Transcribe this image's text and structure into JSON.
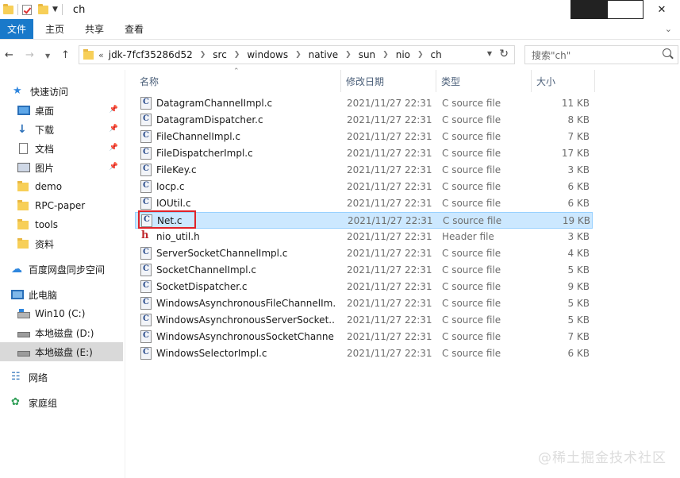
{
  "window": {
    "title": "ch",
    "controls": {
      "minimize": "minimize",
      "maximize": "maximize",
      "close": "✕"
    }
  },
  "quick_access_toolbar": {
    "icons": [
      "folder-icon",
      "properties-icon",
      "new-folder-icon",
      "customize-dropdown-icon"
    ]
  },
  "ribbon": {
    "tabs": [
      {
        "label": "文件",
        "active": true
      },
      {
        "label": "主页"
      },
      {
        "label": "共享"
      },
      {
        "label": "查看"
      }
    ]
  },
  "navigation": {
    "back": "←",
    "forward": "→",
    "up": "↑",
    "address": {
      "lead": "«",
      "crumbs": [
        "jdk-7fcf35286d52",
        "src",
        "windows",
        "native",
        "sun",
        "nio",
        "ch"
      ]
    },
    "search": {
      "placeholder": "搜索\"ch\""
    }
  },
  "sidebar": {
    "quick_access": {
      "label": "快速访问"
    },
    "pinned": [
      {
        "label": "桌面",
        "icon": "desktop-icon",
        "pinned": true
      },
      {
        "label": "下载",
        "icon": "download-icon",
        "pinned": true
      },
      {
        "label": "文档",
        "icon": "document-icon",
        "pinned": true
      },
      {
        "label": "图片",
        "icon": "pictures-icon",
        "pinned": true
      }
    ],
    "folders": [
      {
        "label": "demo"
      },
      {
        "label": "RPC-paper"
      },
      {
        "label": "tools"
      },
      {
        "label": "资料"
      }
    ],
    "baidu": {
      "label": "百度网盘同步空间"
    },
    "this_pc": {
      "label": "此电脑"
    },
    "drives": [
      {
        "label": "Win10 (C:)"
      },
      {
        "label": "本地磁盘 (D:)"
      },
      {
        "label": "本地磁盘 (E:)",
        "selected": true
      }
    ],
    "network": {
      "label": "网络"
    },
    "homegroup": {
      "label": "家庭组"
    }
  },
  "columns": {
    "name": "名称",
    "date": "修改日期",
    "type": "类型",
    "size": "大小"
  },
  "files": [
    {
      "name": "DatagramChannelImpl.c",
      "date": "2021/11/27 22:31",
      "type": "C source file",
      "size": "11 KB",
      "kind": "c"
    },
    {
      "name": "DatagramDispatcher.c",
      "date": "2021/11/27 22:31",
      "type": "C source file",
      "size": "8 KB",
      "kind": "c"
    },
    {
      "name": "FileChannelImpl.c",
      "date": "2021/11/27 22:31",
      "type": "C source file",
      "size": "7 KB",
      "kind": "c"
    },
    {
      "name": "FileDispatcherImpl.c",
      "date": "2021/11/27 22:31",
      "type": "C source file",
      "size": "17 KB",
      "kind": "c"
    },
    {
      "name": "FileKey.c",
      "date": "2021/11/27 22:31",
      "type": "C source file",
      "size": "3 KB",
      "kind": "c"
    },
    {
      "name": "Iocp.c",
      "date": "2021/11/27 22:31",
      "type": "C source file",
      "size": "6 KB",
      "kind": "c"
    },
    {
      "name": "IOUtil.c",
      "date": "2021/11/27 22:31",
      "type": "C source file",
      "size": "6 KB",
      "kind": "c"
    },
    {
      "name": "Net.c",
      "date": "2021/11/27 22:31",
      "type": "C source file",
      "size": "19 KB",
      "kind": "c",
      "selected": true
    },
    {
      "name": "nio_util.h",
      "date": "2021/11/27 22:31",
      "type": "Header file",
      "size": "3 KB",
      "kind": "h"
    },
    {
      "name": "ServerSocketChannelImpl.c",
      "date": "2021/11/27 22:31",
      "type": "C source file",
      "size": "4 KB",
      "kind": "c"
    },
    {
      "name": "SocketChannelImpl.c",
      "date": "2021/11/27 22:31",
      "type": "C source file",
      "size": "5 KB",
      "kind": "c"
    },
    {
      "name": "SocketDispatcher.c",
      "date": "2021/11/27 22:31",
      "type": "C source file",
      "size": "9 KB",
      "kind": "c"
    },
    {
      "name": "WindowsAsynchronousFileChannelIm...",
      "date": "2021/11/27 22:31",
      "type": "C source file",
      "size": "5 KB",
      "kind": "c"
    },
    {
      "name": "WindowsAsynchronousServerSocket...",
      "date": "2021/11/27 22:31",
      "type": "C source file",
      "size": "5 KB",
      "kind": "c"
    },
    {
      "name": "WindowsAsynchronousSocketChanne...",
      "date": "2021/11/27 22:31",
      "type": "C source file",
      "size": "7 KB",
      "kind": "c"
    },
    {
      "name": "WindowsSelectorImpl.c",
      "date": "2021/11/27 22:31",
      "type": "C source file",
      "size": "6 KB",
      "kind": "c"
    }
  ],
  "watermark": "@稀土掘金技术社区",
  "colors": {
    "accent": "#1979ca",
    "selection": "#cce8ff",
    "highlight_box": "#e0232a"
  }
}
